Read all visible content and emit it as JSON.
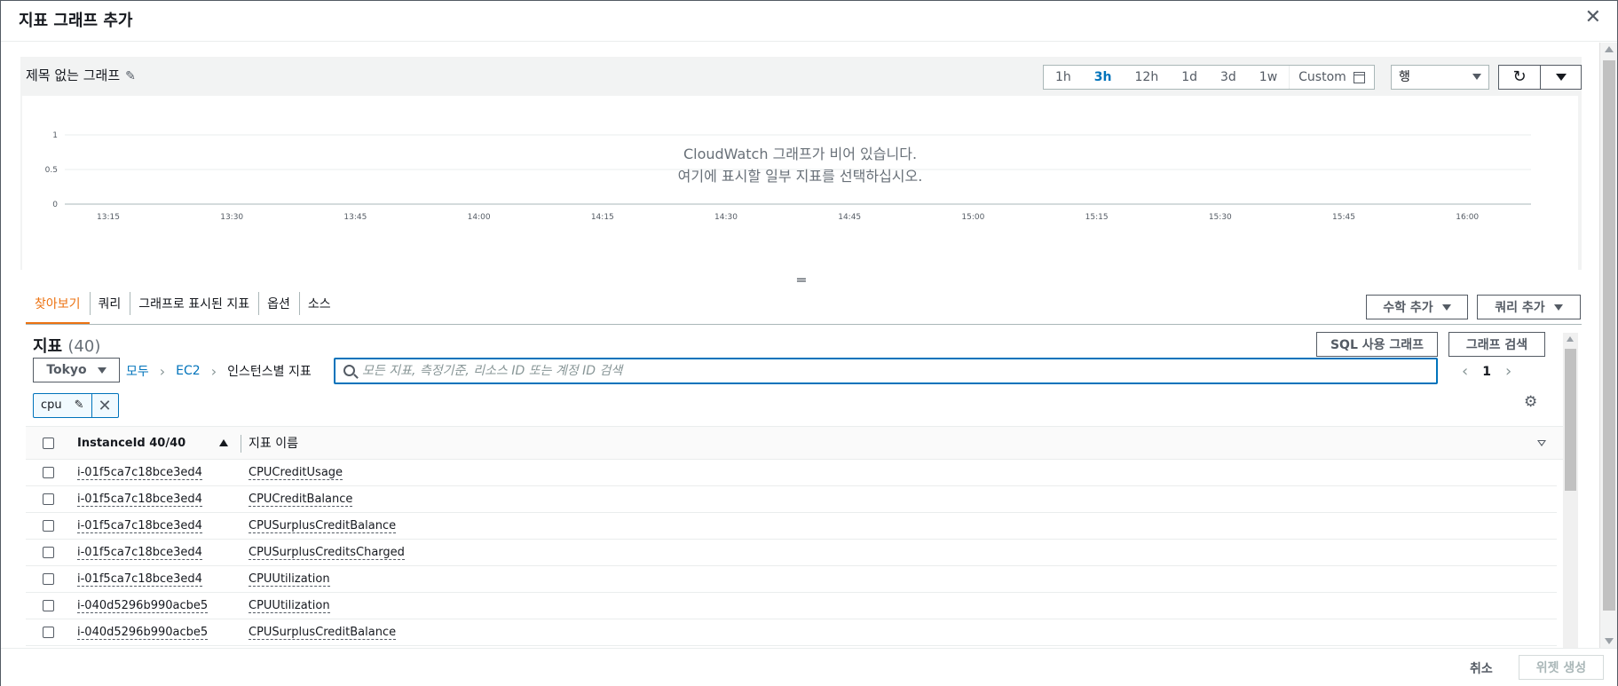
{
  "modal": {
    "title": "지표 그래프 추가",
    "close_icon": "close-icon"
  },
  "graph": {
    "title": "제목 없는 그래프",
    "time_ranges": [
      "1h",
      "3h",
      "12h",
      "1d",
      "3d",
      "1w"
    ],
    "active_time_range": "3h",
    "custom_label": "Custom",
    "graph_type_value": "행",
    "empty_line1": "CloudWatch 그래프가 비어 있습니다.",
    "empty_line2": "여기에 표시할 일부 지표를 선택하십시오.",
    "chart_data": {
      "type": "line",
      "y_ticks": [
        "1",
        "0.5",
        "0"
      ],
      "ylim": [
        0,
        1
      ],
      "x_ticks": [
        "13:15",
        "13:30",
        "13:45",
        "14:00",
        "14:15",
        "14:30",
        "14:45",
        "15:00",
        "15:15",
        "15:30",
        "15:45",
        "16:00"
      ],
      "series": [],
      "grid": true
    }
  },
  "tabs": [
    "찾아보기",
    "쿼리",
    "그래프로 표시된 지표",
    "옵션",
    "소스"
  ],
  "active_tab": "찾아보기",
  "actions": {
    "add_math": "수학 추가",
    "add_query": "쿼리 추가",
    "sql_graph": "SQL 사용 그래프",
    "graph_search": "그래프 검색"
  },
  "browse": {
    "heading": "지표",
    "count": "(40)",
    "region": "Tokyo",
    "breadcrumbs": [
      "모두",
      "EC2",
      "인스턴스별 지표"
    ],
    "search_placeholder": "모든 지표, 측정기준, 리소스 ID 또는 계정 ID 검색",
    "page": "1",
    "filter_token": "cpu",
    "columns": [
      "InstanceId 40/40",
      "지표 이름"
    ],
    "rows": [
      {
        "id": "i-01f5ca7c18bce3ed4",
        "metric": "CPUCreditUsage"
      },
      {
        "id": "i-01f5ca7c18bce3ed4",
        "metric": "CPUCreditBalance"
      },
      {
        "id": "i-01f5ca7c18bce3ed4",
        "metric": "CPUSurplusCreditBalance"
      },
      {
        "id": "i-01f5ca7c18bce3ed4",
        "metric": "CPUSurplusCreditsCharged"
      },
      {
        "id": "i-01f5ca7c18bce3ed4",
        "metric": "CPUUtilization"
      },
      {
        "id": "i-040d5296b990acbe5",
        "metric": "CPUUtilization"
      },
      {
        "id": "i-040d5296b990acbe5",
        "metric": "CPUSurplusCreditBalance"
      }
    ]
  },
  "footer": {
    "cancel": "취소",
    "create": "위젯 생성"
  },
  "colors": {
    "accent": "#ec7211",
    "link": "#0073bb"
  }
}
